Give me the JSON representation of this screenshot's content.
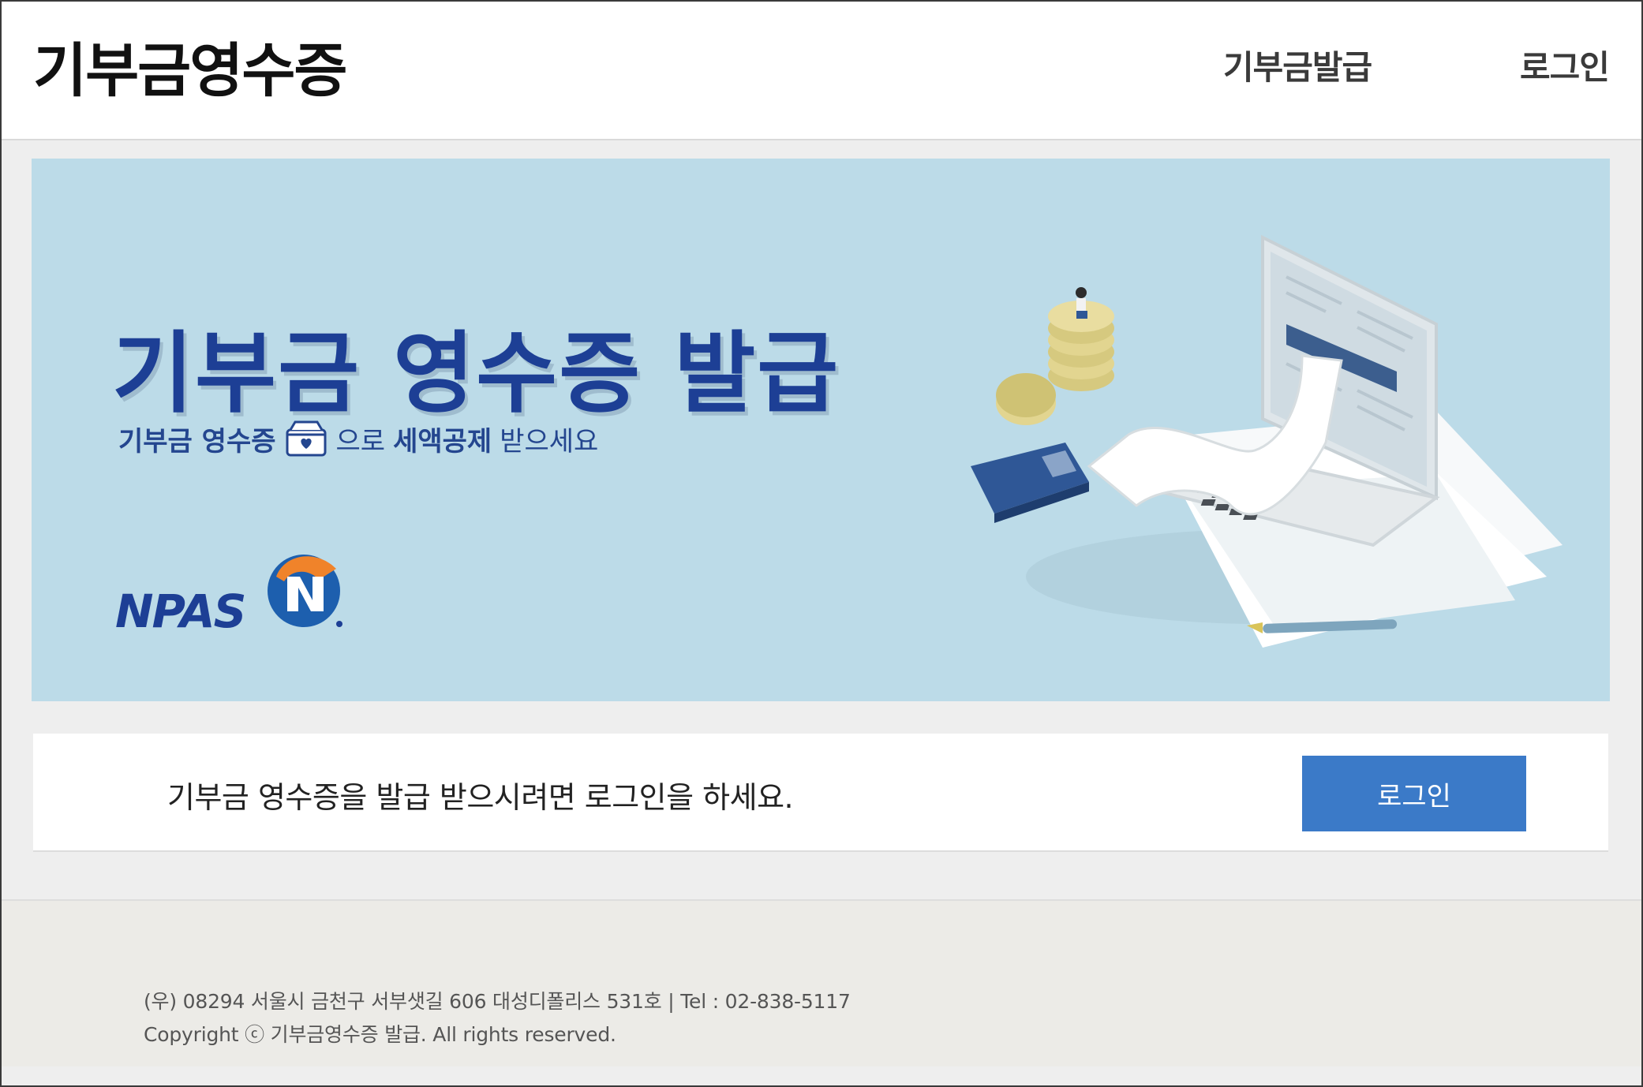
{
  "header": {
    "brand": "기부금영수증",
    "nav": {
      "issue": "기부금발급",
      "login": "로그인"
    }
  },
  "banner": {
    "title": "기부금 영수증 발급",
    "subtitle": {
      "part1": "기부금 영수증",
      "part2": "으로",
      "part3": "세액공제",
      "part4": "받으세요"
    },
    "logo_text": "NPAS"
  },
  "login_prompt": {
    "message": "기부금 영수증을 발급 받으시려면 로그인을 하세요.",
    "button_label": "로그인"
  },
  "footer": {
    "address": "(우) 08294 서울시 금천구 서부샛길 606 대성디폴리스 531호 | Tel : 02-838-5117",
    "copyright": "Copyright ⓒ 기부금영수증 발급. All rights reserved."
  },
  "colors": {
    "banner_bg": "#bcdbe8",
    "title_blue": "#1d3f95",
    "button_blue": "#3b7ac8",
    "npas_orange": "#f0832a"
  }
}
